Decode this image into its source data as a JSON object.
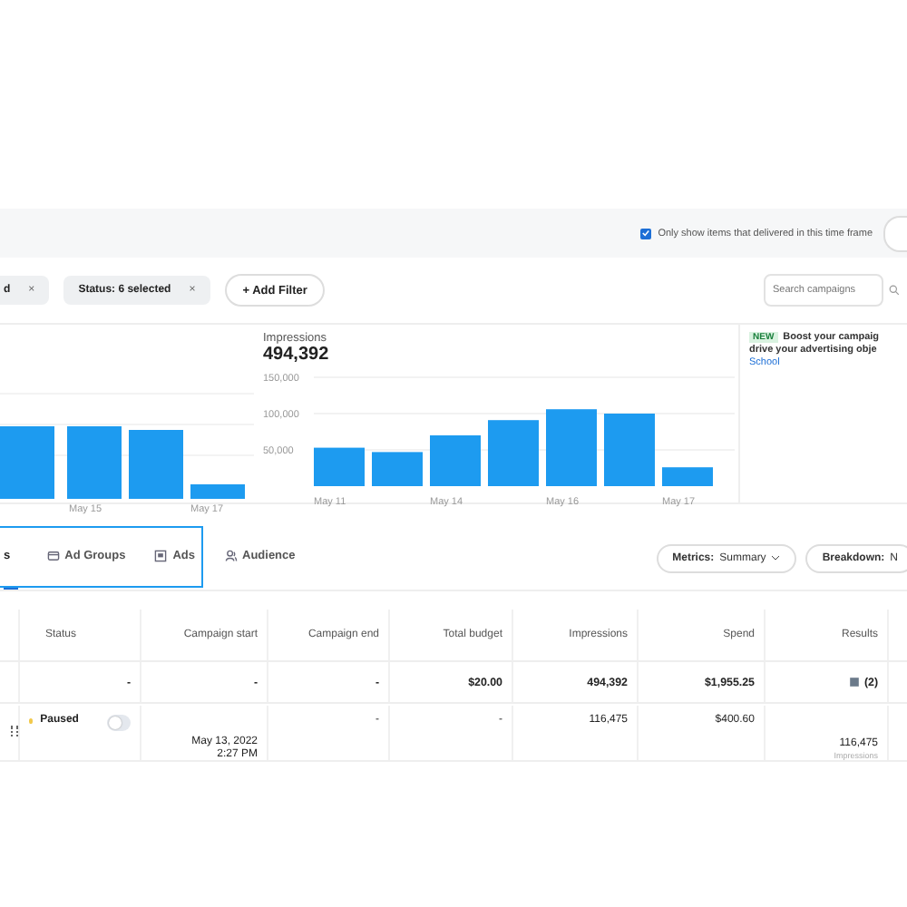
{
  "timeframe_option": {
    "label": "Only show items that delivered in this time frame",
    "checked": true
  },
  "filters": [
    {
      "label": "d",
      "remove": "×"
    },
    {
      "label": "Status: 6 selected",
      "remove": "×"
    }
  ],
  "add_filter": "+ Add Filter",
  "search": {
    "placeholder": "Search campaigns"
  },
  "left_chart": {
    "xlabels": [
      "May 15",
      "May 17"
    ]
  },
  "impressions_chart": {
    "title": "Impressions",
    "total": "494,392",
    "chart_data": {
      "type": "bar",
      "categories": [
        "May 11",
        null,
        "May 14",
        null,
        "May 16",
        null,
        "May 17"
      ],
      "values": [
        53000,
        47000,
        70000,
        91000,
        106000,
        100000,
        26000
      ],
      "ylim": [
        0,
        150000
      ],
      "yticks": [
        {
          "value": 50000,
          "label": "50,000"
        },
        {
          "value": 100000,
          "label": "100,000"
        },
        {
          "value": 150000,
          "label": "150,000"
        }
      ]
    }
  },
  "promo": {
    "badge": "NEW",
    "lines": [
      "Boost your campaig",
      "drive your advertising obje"
    ],
    "link": "School"
  },
  "tabs": [
    {
      "label": "s",
      "kind": "plain",
      "selected": true
    },
    {
      "label": "Ad Groups",
      "kind": "folder",
      "selected": false
    },
    {
      "label": "Ads",
      "kind": "image",
      "selected": false
    },
    {
      "label": "Audience",
      "kind": "people",
      "selected": false
    }
  ],
  "metrics_button": {
    "key": "Metrics:",
    "value": "Summary"
  },
  "breakdown_button": {
    "key": "Breakdown:",
    "value": "N"
  },
  "table": {
    "columns": [
      "Status",
      "Campaign start",
      "Campaign end",
      "Total budget",
      "Impressions",
      "Spend",
      "Results"
    ],
    "totals": {
      "status": "-",
      "start": "-",
      "end": "-",
      "budget": "$20.00",
      "impressions": "494,392",
      "spend": "$1,955.25",
      "results": "(2)"
    },
    "rows": [
      {
        "status": "Paused",
        "color": "#f2c94c",
        "on": false,
        "start": [
          "May 13, 2022",
          "2:27 PM"
        ],
        "end": "-",
        "budget": "-",
        "impressions": "116,475",
        "spend": "$400.60",
        "results": "116,475",
        "results_unit": "Impressions"
      }
    ]
  }
}
